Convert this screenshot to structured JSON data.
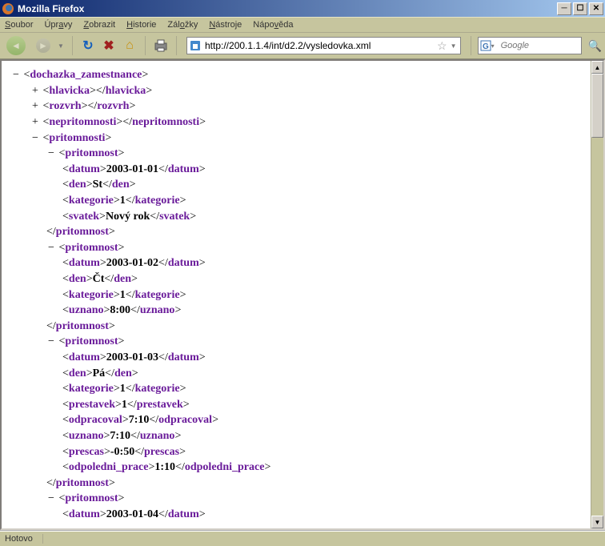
{
  "window": {
    "title": "Mozilla Firefox"
  },
  "menu": {
    "file": "Soubor",
    "edit": "Úpravy",
    "view": "Zobrazit",
    "history": "Historie",
    "bookmarks": "Záložky",
    "tools": "Nástroje",
    "help": "Nápověda"
  },
  "url": {
    "value": "http://200.1.1.4/int/d2.2/vysledovka.xml"
  },
  "search": {
    "placeholder": "Google"
  },
  "status": {
    "text": "Hotovo"
  },
  "xml": {
    "root": "dochazka_zamestnance",
    "hlavicka": "hlavicka",
    "rozvrh": "rozvrh",
    "nepritomnosti": "nepritomnosti",
    "pritomnosti": "pritomnosti",
    "pritomnost": "pritomnost",
    "datum": "datum",
    "den": "den",
    "kategorie": "kategorie",
    "svatek": "svatek",
    "uznano": "uznano",
    "prestavek": "prestavek",
    "odpracoval": "odpracoval",
    "prescas": "prescas",
    "odpoledni_prace": "odpoledni_prace",
    "records": [
      {
        "datum": "2003-01-01",
        "den": "St",
        "kategorie": "1",
        "svatek": "Nový rok"
      },
      {
        "datum": "2003-01-02",
        "den": "Čt",
        "kategorie": "1",
        "uznano": "8:00"
      },
      {
        "datum": "2003-01-03",
        "den": "Pá",
        "kategorie": "1",
        "prestavek": "1",
        "odpracoval": "7:10",
        "uznano": "7:10",
        "prescas": "-0:50",
        "odpoledni_prace": "1:10"
      },
      {
        "datum": "2003-01-04"
      }
    ]
  }
}
